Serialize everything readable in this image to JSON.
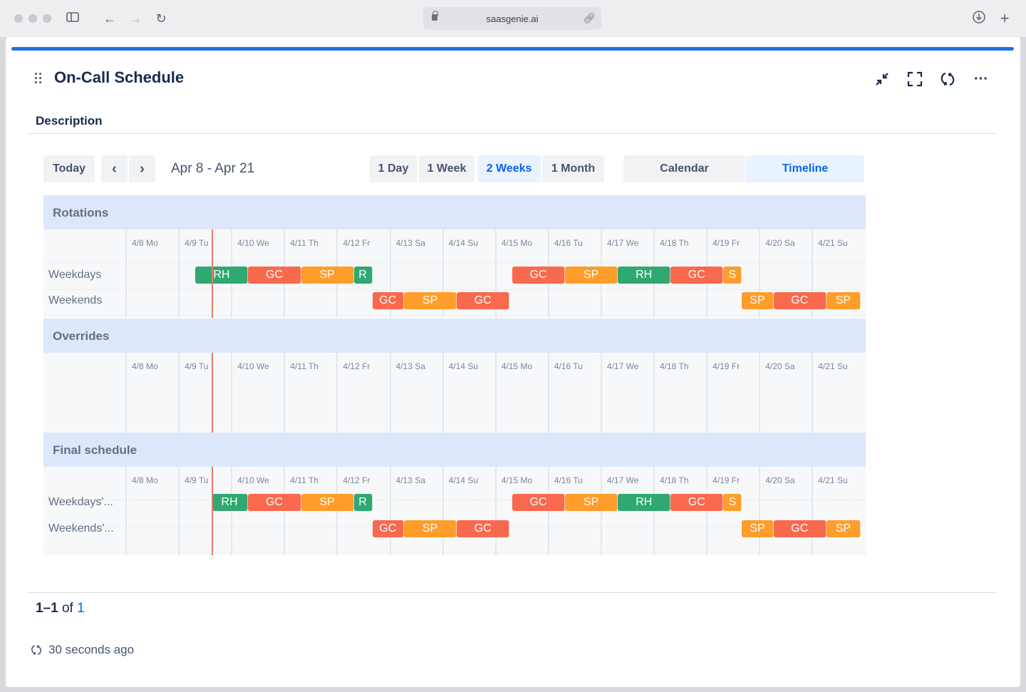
{
  "browser": {
    "url": "saasgenie.ai"
  },
  "panel": {
    "title": "On-Call Schedule",
    "tab_description": "Description"
  },
  "toolbar": {
    "today": "Today",
    "prev": "‹",
    "next": "›",
    "range": "Apr 8 - Apr 21",
    "views": [
      "1 Day",
      "1 Week",
      "2 Weeks",
      "1 Month"
    ],
    "active_view": "2 Weeks",
    "modes": [
      "Calendar",
      "Timeline"
    ],
    "active_mode": "Timeline"
  },
  "days": [
    "4/8 Mo",
    "4/9 Tu",
    "4/10 We",
    "4/11 Th",
    "4/12 Fr",
    "4/13 Sa",
    "4/14 Su",
    "4/15 Mo",
    "4/16 Tu",
    "4/17 We",
    "4/18 Th",
    "4/19 Fr",
    "4/20 Sa",
    "4/21 Su"
  ],
  "sections": [
    {
      "name": "Rotations",
      "rows": [
        {
          "label": "Weekdays",
          "bars": [
            {
              "text": "RH",
              "color": "green"
            },
            {
              "text": "GC",
              "color": "red"
            },
            {
              "text": "SP",
              "color": "orange"
            },
            {
              "text": "R",
              "color": "green"
            },
            {
              "text": "GC",
              "color": "red"
            },
            {
              "text": "SP",
              "color": "orange"
            },
            {
              "text": "RH",
              "color": "green"
            },
            {
              "text": "GC",
              "color": "red"
            },
            {
              "text": "S",
              "color": "orange"
            }
          ]
        },
        {
          "label": "Weekends",
          "bars": [
            {
              "text": "GC",
              "color": "red"
            },
            {
              "text": "SP",
              "color": "orange"
            },
            {
              "text": "GC",
              "color": "red"
            },
            {
              "text": "SP",
              "color": "orange"
            },
            {
              "text": "GC",
              "color": "red"
            },
            {
              "text": "SP",
              "color": "orange"
            }
          ]
        }
      ]
    },
    {
      "name": "Overrides",
      "rows": []
    },
    {
      "name": "Final schedule",
      "rows": [
        {
          "label": "Weekdays'...",
          "bars": [
            {
              "text": "RH",
              "color": "green"
            },
            {
              "text": "GC",
              "color": "red"
            },
            {
              "text": "SP",
              "color": "orange"
            },
            {
              "text": "R",
              "color": "green"
            },
            {
              "text": "GC",
              "color": "red"
            },
            {
              "text": "SP",
              "color": "orange"
            },
            {
              "text": "RH",
              "color": "green"
            },
            {
              "text": "GC",
              "color": "red"
            },
            {
              "text": "S",
              "color": "orange"
            }
          ]
        },
        {
          "label": "Weekends'...",
          "bars": [
            {
              "text": "GC",
              "color": "red"
            },
            {
              "text": "SP",
              "color": "orange"
            },
            {
              "text": "GC",
              "color": "red"
            },
            {
              "text": "SP",
              "color": "orange"
            },
            {
              "text": "GC",
              "color": "red"
            },
            {
              "text": "SP",
              "color": "orange"
            }
          ]
        }
      ]
    }
  ],
  "footer": {
    "range_bold": "1–1",
    "of_text": "of",
    "total": "1",
    "refreshed": "30 seconds ago"
  },
  "colors": {
    "accent": "#1f6fe5",
    "red": "#f8694e",
    "orange": "#ff9d2b",
    "green": "#2fa872",
    "now_line": "#e8796a"
  }
}
